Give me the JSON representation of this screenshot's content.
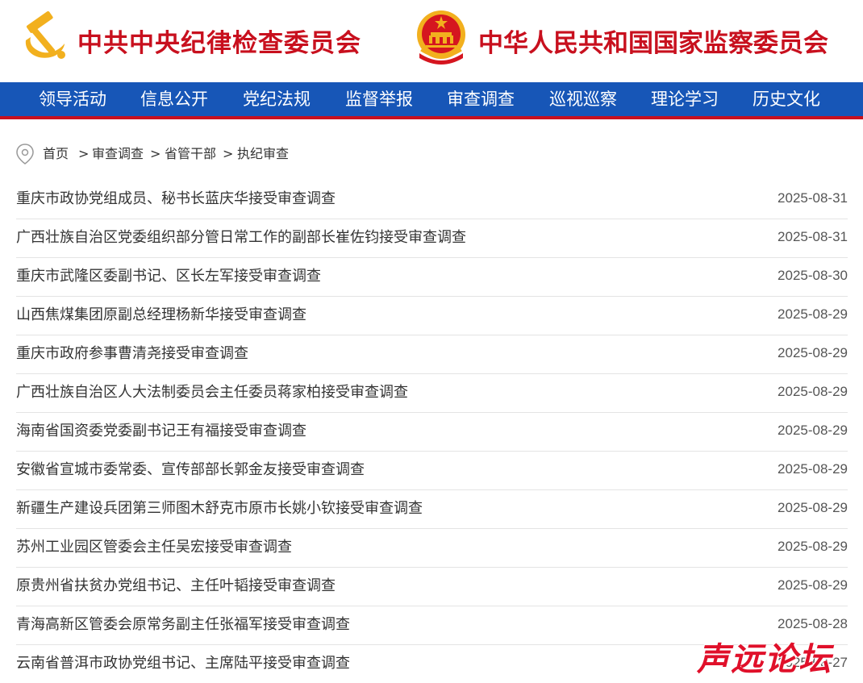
{
  "header": {
    "org_left": "中共中央纪律检查委员会",
    "org_right": "中华人民共和国国家监察委员会"
  },
  "nav": {
    "items": [
      "领导活动",
      "信息公开",
      "党纪法规",
      "监督举报",
      "审查调查",
      "巡视巡察",
      "理论学习",
      "历史文化"
    ]
  },
  "breadcrumb": {
    "items": [
      "首页",
      "审查调查",
      "省管干部",
      "执纪审查"
    ],
    "separator": ">"
  },
  "articles": [
    {
      "title": "重庆市政协党组成员、秘书长蓝庆华接受审查调查",
      "date": "2025-08-31"
    },
    {
      "title": "广西壮族自治区党委组织部分管日常工作的副部长崔佐钧接受审查调查",
      "date": "2025-08-31"
    },
    {
      "title": "重庆市武隆区委副书记、区长左军接受审查调查",
      "date": "2025-08-30"
    },
    {
      "title": "山西焦煤集团原副总经理杨新华接受审查调查",
      "date": "2025-08-29"
    },
    {
      "title": "重庆市政府参事曹清尧接受审查调查",
      "date": "2025-08-29"
    },
    {
      "title": "广西壮族自治区人大法制委员会主任委员蒋家柏接受审查调查",
      "date": "2025-08-29"
    },
    {
      "title": "海南省国资委党委副书记王有福接受审查调查",
      "date": "2025-08-29"
    },
    {
      "title": "安徽省宣城市委常委、宣传部部长郭金友接受审查调查",
      "date": "2025-08-29"
    },
    {
      "title": "新疆生产建设兵团第三师图木舒克市原市长姚小钦接受审查调查",
      "date": "2025-08-29"
    },
    {
      "title": "苏州工业园区管委会主任吴宏接受审查调查",
      "date": "2025-08-29"
    },
    {
      "title": "原贵州省扶贫办党组书记、主任叶韬接受审查调查",
      "date": "2025-08-29"
    },
    {
      "title": "青海高新区管委会原常务副主任张福军接受审查调查",
      "date": "2025-08-28"
    },
    {
      "title": "云南省普洱市政协党组书记、主席陆平接受审查调查",
      "date": "2025-08-27"
    }
  ],
  "watermark": "声远论坛",
  "colors": {
    "brand_red": "#c8101e",
    "nav_blue": "#1756b7",
    "emblem_gold": "#f2b01e"
  },
  "icons": {
    "party_emblem": "hammer-sickle-icon",
    "national_emblem": "national-emblem-icon",
    "location": "location-pin-icon"
  }
}
